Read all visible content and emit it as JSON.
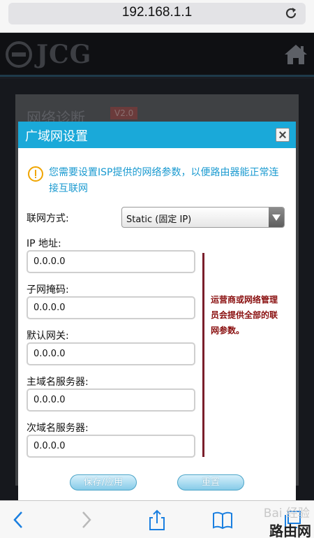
{
  "browser": {
    "url": "192.168.1.1",
    "reload_icon": "reload-icon",
    "toolbar_icons": [
      "back-icon",
      "forward-icon",
      "share-icon",
      "bookmarks-icon",
      "tabs-icon"
    ]
  },
  "site": {
    "brand": "JCG",
    "home_icon": "home-icon",
    "page_title": "网络诊断",
    "version_badge": "V2.0"
  },
  "modal": {
    "title": "广域网设置",
    "notice": "您需要设置ISP提供的网络参数，以便路由器能正常连接互联网",
    "connection_label": "联网方式:",
    "connection_value": "Static (固定 IP)",
    "fields": [
      {
        "label": "IP 地址:",
        "value": "0.0.0.0"
      },
      {
        "label": "子网掩码:",
        "value": "0.0.0.0"
      },
      {
        "label": "默认网关:",
        "value": "0.0.0.0"
      },
      {
        "label": "主域名服务器:",
        "value": "0.0.0.0"
      },
      {
        "label": "次域名服务器:",
        "value": "0.0.0.0"
      }
    ],
    "annotation": "运营商或网络管理员会提供全部的联网参数。",
    "save_label": "保存/应用",
    "reset_label": "重置"
  },
  "watermark": {
    "line1": "Bai 经验",
    "line2": "路由网"
  },
  "colors": {
    "header_blue": "#1aa9d9",
    "notice_blue": "#1a9ad0",
    "annotation_red": "#8a1010"
  }
}
